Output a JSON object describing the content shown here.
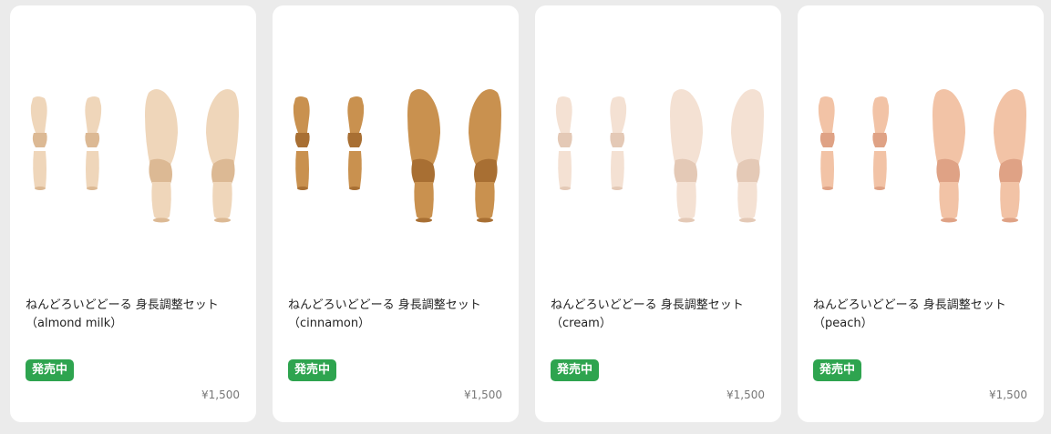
{
  "products": [
    {
      "name": "ねんどろいどどーる 身長調整セット",
      "variant": "（almond milk）",
      "status": "発売中",
      "price": "¥1,500",
      "color": "#efd6ba",
      "shade": "#dcb994"
    },
    {
      "name": "ねんどろいどどーる 身長調整セット",
      "variant": "（cinnamon）",
      "status": "発売中",
      "price": "¥1,500",
      "color": "#c9914f",
      "shade": "#a86f33"
    },
    {
      "name": "ねんどろいどどーる 身長調整セット",
      "variant": "（cream）",
      "status": "発売中",
      "price": "¥1,500",
      "color": "#f4e1d3",
      "shade": "#e4c9b6"
    },
    {
      "name": "ねんどろいどどーる 身長調整セット",
      "variant": "（peach）",
      "status": "発売中",
      "price": "¥1,500",
      "color": "#f2c3a6",
      "shade": "#df a285"
    }
  ],
  "colors": {
    "badge": "#2ea44f",
    "card": "#ffffff",
    "background": "#ebebeb"
  }
}
